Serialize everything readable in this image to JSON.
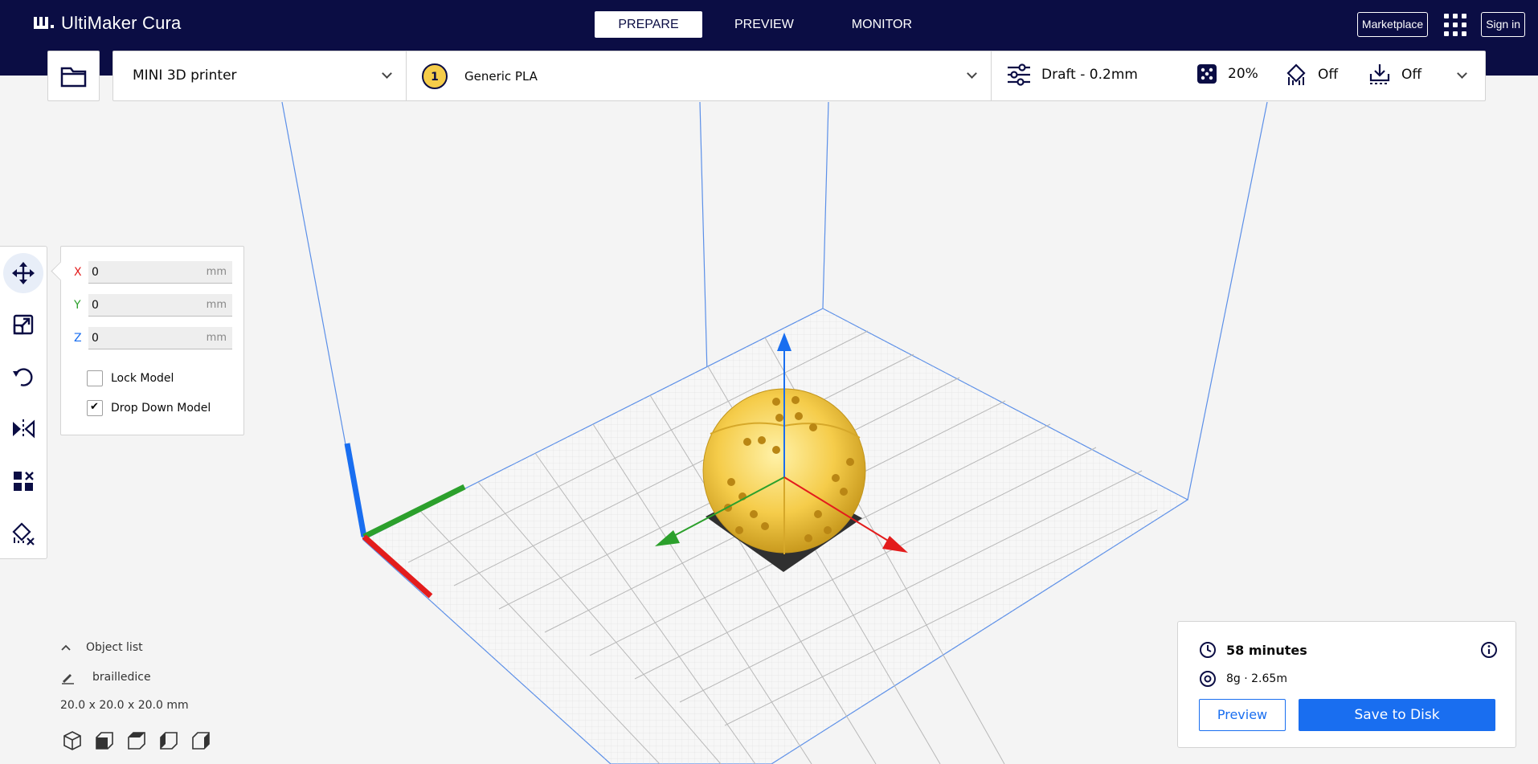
{
  "app": {
    "name": "UltiMaker Cura"
  },
  "stages": [
    {
      "label": "PREPARE",
      "active": true
    },
    {
      "label": "PREVIEW",
      "active": false
    },
    {
      "label": "MONITOR",
      "active": false
    }
  ],
  "header": {
    "marketplace_label": "Marketplace",
    "signin_label": "Sign in"
  },
  "config": {
    "printer_name": "MINI 3D printer",
    "material": {
      "extruder_number": "1",
      "name": "Generic PLA"
    },
    "profile": "Draft - 0.2mm",
    "infill": "20%",
    "support": "Off",
    "adhesion": "Off"
  },
  "translate": {
    "x": {
      "label": "X",
      "value": "0",
      "unit": "mm",
      "color": "#e31c1c"
    },
    "y": {
      "label": "Y",
      "value": "0",
      "unit": "mm",
      "color": "#2ca02c"
    },
    "z": {
      "label": "Z",
      "value": "0",
      "unit": "mm",
      "color": "#196ef0"
    },
    "lock_model_label": "Lock Model",
    "lock_model_checked": false,
    "drop_down_label": "Drop Down Model",
    "drop_down_checked": true
  },
  "object_list": {
    "title": "Object list",
    "item_name": "brailledice",
    "dimensions": "20.0 x 20.0 x 20.0 mm"
  },
  "print_info": {
    "time": "58 minutes",
    "material_usage": "8g · 2.65m",
    "preview_label": "Preview",
    "save_label": "Save to Disk"
  },
  "colors": {
    "header_bg": "#0b0d44",
    "accent_blue": "#196ef0",
    "model_yellow": "#f5cc4a"
  }
}
